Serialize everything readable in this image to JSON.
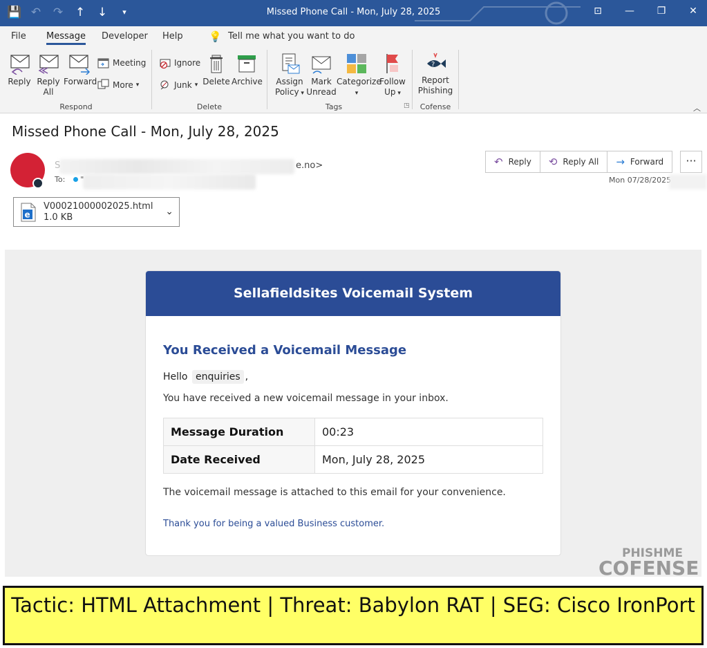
{
  "window": {
    "title": "Missed Phone Call - Mon, July 28, 2025"
  },
  "menu": {
    "tabs": [
      "File",
      "Message",
      "Developer",
      "Help"
    ],
    "active_tab": "Message",
    "tell_me": "Tell me what you want to do"
  },
  "ribbon": {
    "respond": {
      "label": "Respond",
      "reply": "Reply",
      "reply_all_1": "Reply",
      "reply_all_2": "All",
      "forward": "Forward",
      "meeting": "Meeting",
      "more": "More"
    },
    "delete": {
      "label": "Delete",
      "ignore": "Ignore",
      "junk": "Junk",
      "delete": "Delete",
      "archive": "Archive"
    },
    "tags": {
      "label": "Tags",
      "assign_1": "Assign",
      "assign_2": "Policy",
      "mark_1": "Mark",
      "mark_2": "Unread",
      "categorize": "Categorize",
      "follow_1": "Follow",
      "follow_2": "Up"
    },
    "cofense": {
      "label": "Cofense",
      "report_1": "Report",
      "report_2": "Phishing"
    }
  },
  "message": {
    "subject": "Missed Phone Call - Mon, July 28, 2025",
    "sender_first": "S",
    "sender_tail": "e.no>",
    "to_label": "To:",
    "to_value": "\"",
    "date": "Mon 07/28/2025",
    "actions": {
      "reply": "Reply",
      "reply_all": "Reply All",
      "forward": "Forward"
    },
    "attachment": {
      "name": "V00021000002025.html",
      "size": "1.0 KB"
    }
  },
  "email": {
    "banner": "Sellafieldsites Voicemail System",
    "heading": "You Received a Voicemail Message",
    "hello_prefix": "Hello",
    "recipient": "enquiries",
    "hello_suffix": ",",
    "intro": "You have received a new voicemail message in your inbox.",
    "rows": [
      {
        "key": "Message Duration",
        "value": "00:23"
      },
      {
        "key": "Date Received",
        "value": "Mon, July 28, 2025"
      }
    ],
    "attached_note": "The voicemail message is attached to this email for your convenience.",
    "thanks": "Thank you for being a valued Business customer."
  },
  "watermark": {
    "top": "PHISHME",
    "bottom": "COFENSE"
  },
  "caption": "Tactic: HTML Attachment | Threat: Babylon RAT | SEG: Cisco IronPort",
  "colors": {
    "titlebar": "#2b579a",
    "email_banner": "#2b4c96",
    "caption_bg": "#ffff66"
  }
}
